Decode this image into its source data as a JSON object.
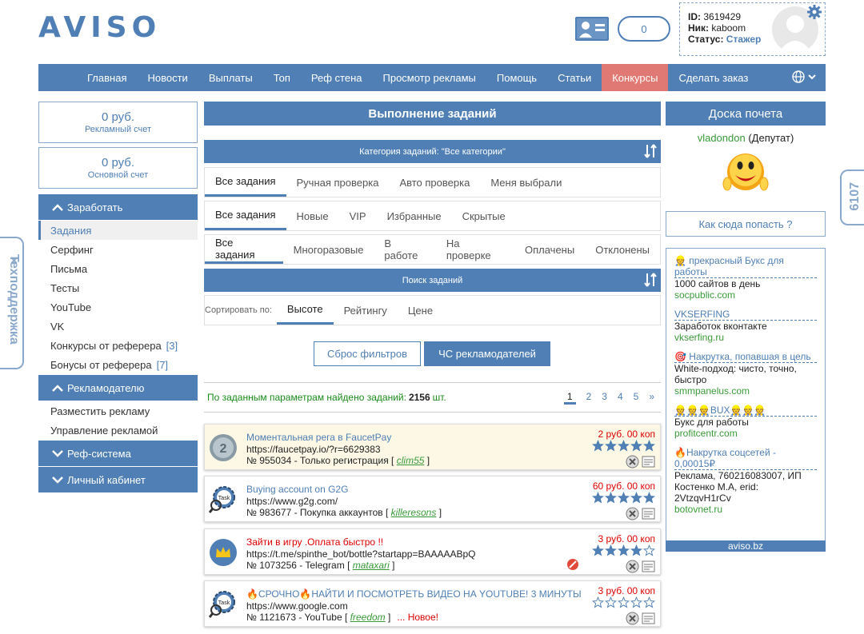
{
  "header": {
    "logo": "AVISO",
    "messages_count": "0",
    "user": {
      "id_label": "ID:",
      "id": "3619429",
      "nick_label": "Ник:",
      "nick": "kaboom",
      "status_label": "Статус:",
      "status": "Стажер"
    }
  },
  "nav": {
    "items": [
      "Главная",
      "Новости",
      "Выплаты",
      "Топ",
      "Реф стена",
      "Просмотр рекламы",
      "Помощь",
      "Статьи",
      "Конкурсы",
      "Сделать заказ"
    ],
    "active_index": 8
  },
  "balances": [
    {
      "amount": "0 руб.",
      "label": "Рекламный счет"
    },
    {
      "amount": "0 руб.",
      "label": "Основной счет"
    }
  ],
  "sidebar": {
    "earn": {
      "title": "Заработать",
      "items": [
        {
          "label": "Задания",
          "count": ""
        },
        {
          "label": "Серфинг",
          "count": ""
        },
        {
          "label": "Письма",
          "count": ""
        },
        {
          "label": "Тесты",
          "count": ""
        },
        {
          "label": "YouTube",
          "count": ""
        },
        {
          "label": "VK",
          "count": ""
        },
        {
          "label": "Конкурсы от реферера",
          "count": "[3]"
        },
        {
          "label": "Бонусы от реферера",
          "count": "[7]"
        }
      ]
    },
    "advertiser": {
      "title": "Рекламодателю",
      "items": [
        "Разместить рекламу",
        "Управление рекламой"
      ]
    },
    "ref": {
      "title": "Реф-система"
    },
    "cabinet": {
      "title": "Личный кабинет"
    }
  },
  "center": {
    "title": "Выполнение заданий",
    "category_bar": "Категория заданий: \"Все категории\"",
    "tabs1": [
      "Все задания",
      "Ручная проверка",
      "Авто проверка",
      "Меня выбрали"
    ],
    "tabs2": [
      "Все задания",
      "Новые",
      "VIP",
      "Избранные",
      "Скрытые"
    ],
    "tabs3": [
      "Все задания",
      "Многоразовые",
      "В работе",
      "На проверке",
      "Оплачены",
      "Отклонены"
    ],
    "search_bar": "Поиск заданий",
    "sort_label": "Сортировать по:",
    "sort_tabs": [
      "Высоте",
      "Рейтингу",
      "Цене"
    ],
    "reset_btn": "Сброс фильтров",
    "blacklist_btn": "ЧС рекламодателей",
    "found_prefix": "По заданным параметрам найдено заданий:",
    "found_count": "2156",
    "found_suffix": "шт.",
    "pages": [
      "1",
      "2",
      "3",
      "4",
      "5",
      "»"
    ]
  },
  "tasks": [
    {
      "title": "Моментальная рега в FaucetPay",
      "url": "https://faucetpay.io/?r=6629383",
      "info": "№ 955034 - Только регистрация",
      "author": "clim55",
      "price": "2 руб. 00 коп",
      "stars": 5,
      "icon": "badge-2-icon",
      "new_label": ""
    },
    {
      "title": "Buying account on G2G",
      "url": "https://www.g2g.com/",
      "info": "№ 983677 - Покупка аккаунтов",
      "author": "killeresons",
      "price": "60 руб. 00 коп",
      "stars": 5,
      "icon": "task-gear-icon",
      "new_label": ""
    },
    {
      "title": "Зайти в игру .Оплата быстро !!",
      "url": "https://t.me/spinthe_bot/bottle?startapp=BAAAAABpQ",
      "info": "№ 1073256 - Telegram",
      "author": "mataxari",
      "price": "3 руб. 00 коп",
      "stars": 4,
      "icon": "crown-icon",
      "new_label": ""
    },
    {
      "title": "🔥СРОЧНО🔥НАЙТИ И ПОСМОТРЕТЬ ВИДЕО НА YOUTUBE! 3 МИНУТЫ",
      "url": "https://www.google.com",
      "info": "№ 1121673 - YouTube",
      "author": "freedom",
      "price": "3 руб. 00 коп",
      "stars": 0,
      "icon": "task-gear-icon",
      "new_label": "... Новое!"
    }
  ],
  "right": {
    "title": "Доска почета",
    "honor_name": "vladondon",
    "honor_role": "(Депутат)",
    "how_link": "Как сюда попасть ?",
    "ads": [
      {
        "title": "👷 прекрасный Букс для работы",
        "desc": "1000 сайтов в день",
        "url": "socpublic.com"
      },
      {
        "title": "VKSERFING",
        "desc": "Заработок вконтакте",
        "url": "vkserfing.ru"
      },
      {
        "title": "🎯 Накрутка, попавшая в цель",
        "desc": "White-подход: чисто, точно, быстро",
        "url": "smmpanelus.com"
      },
      {
        "title": "👷👷👷BUX👷👷👷",
        "desc": "Букс для работы",
        "url": "profitcentr.com"
      },
      {
        "title": "🔥Накрутка соцсетей - 0,00015₽",
        "desc": "Реклама, 760216083007, ИП Костенко М.А, erid: 2VtzqvH1rCv",
        "url": "botovnet.ru"
      }
    ],
    "footer": "aviso.bz"
  },
  "side": {
    "support": "Техподдержка",
    "counter": "6107",
    "support_close": "×"
  },
  "colors": {
    "primary": "#4f7fb4",
    "active_nav": "#e07873",
    "green": "#3a9a3a",
    "red": "#dd0000"
  }
}
